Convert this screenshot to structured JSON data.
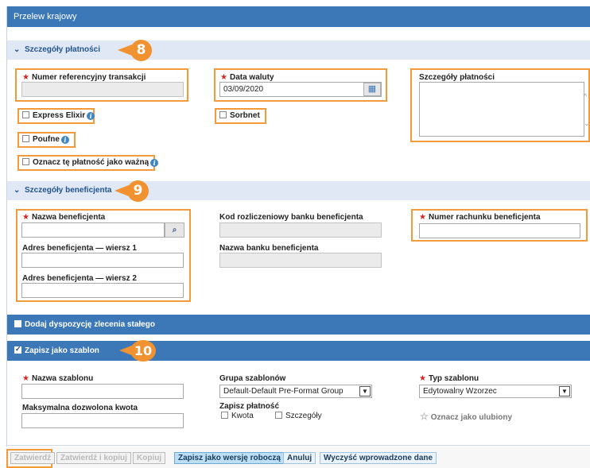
{
  "title": "Przelew krajowy",
  "payment_section": {
    "header": "Szczegóły płatności",
    "badge": "8",
    "transaction_ref_label": "Numer referencyjny transakcji",
    "value_date_label": "Data waluty",
    "value_date_value": "03/09/2020",
    "payment_details_label": "Szczegóły płatności",
    "express_elixir_label": "Express Elixir",
    "sorbnet_label": "Sorbnet",
    "confidential_label": "Poufne",
    "mark_important_label": "Oznacz tę płatność jako ważną"
  },
  "beneficiary_section": {
    "header": "Szczegóły beneficjenta",
    "badge": "9",
    "name_label": "Nazwa beneficjenta",
    "address1_label": "Adres beneficjenta — wiersz 1",
    "address2_label": "Adres beneficjenta — wiersz 2",
    "bank_code_label": "Kod rozliczeniowy banku beneficjenta",
    "bank_name_label": "Nazwa banku beneficjenta",
    "account_number_label": "Numer rachunku beneficjenta"
  },
  "standing_order": {
    "label": "Dodaj dyspozycję zlecenia stałego"
  },
  "template_section": {
    "label": "Zapisz jako szablon",
    "badge": "10",
    "template_name_label": "Nazwa szablonu",
    "template_group_label": "Grupa szablonów",
    "template_group_value": "Default-Default Pre-Format Group",
    "template_type_label": "Typ szablonu",
    "template_type_value": "Edytowalny Wzorzec",
    "max_amount_label": "Maksymalna dozwolona kwota",
    "save_payment_label": "Zapisz płatność",
    "save_amount_option": "Kwota",
    "save_details_option": "Szczegóły",
    "favorite_label": "Oznacz jako ulubiony"
  },
  "buttons": {
    "approve": "Zatwierdź",
    "approve_copy": "Zatwierdź i kopiuj",
    "copy": "Kopiuj",
    "save_draft": "Zapisz jako wersję roboczą",
    "cancel": "Anuluj",
    "clear": "Wyczyść wprowadzone dane"
  },
  "colors": {
    "header_blue": "#3c78b7",
    "section_light": "#dfe8f4",
    "highlight_orange": "#f39a3a"
  }
}
